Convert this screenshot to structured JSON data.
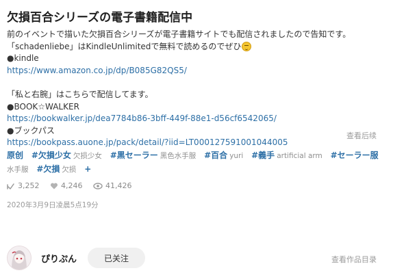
{
  "title": "欠損百合シリーズの電子書籍配信中",
  "description": {
    "line1": "前のイベントで描いた欠損百合シリーズが電子書籍サイトでも配信されましたので告知です。",
    "line2": "「schadenliebe」はKindleUnlimitedで無料で読めるのでぜひ",
    "emoji_icon": "grimacing-face-emoji",
    "kindle_label": "●kindle",
    "kindle_url": "https://www.amazon.co.jp/dp/B085G82QS5/",
    "line5": "「私と右腕」はこちらで配信してます。",
    "bookwalker_label": "●BOOK☆WALKER",
    "bookwalker_url": "https://bookwalker.jp/dea7784b86-3bff-449f-88e1-d56cf6542065/",
    "bookpass_label": "●ブックパス",
    "bookpass_url": "https://bookpass.auone.jp/pack/detail/?iid=LT000127591001044005"
  },
  "view_more": "查看后续",
  "tags": {
    "original": "原创",
    "items": [
      {
        "main": "#欠損少女",
        "sub": "欠损少女"
      },
      {
        "main": "#黒セーラー",
        "sub": "黑色水手服"
      },
      {
        "main": "#百合",
        "sub": "yuri"
      },
      {
        "main": "#義手",
        "sub": "artificial arm"
      },
      {
        "main": "#セーラー服",
        "sub": "水手服"
      },
      {
        "main": "#欠損",
        "sub": "欠损"
      }
    ],
    "add": "+"
  },
  "stats": {
    "likes": "3,252",
    "bookmarks": "4,246",
    "views": "41,426"
  },
  "date": "2020年3月9日凌晨5点19分",
  "author": {
    "name": "ぴりぷん",
    "follow_label": "已关注"
  },
  "catalog_link": "查看作品目录",
  "colors": {
    "link": "#2d6fa6",
    "muted": "#9a9a9a"
  }
}
